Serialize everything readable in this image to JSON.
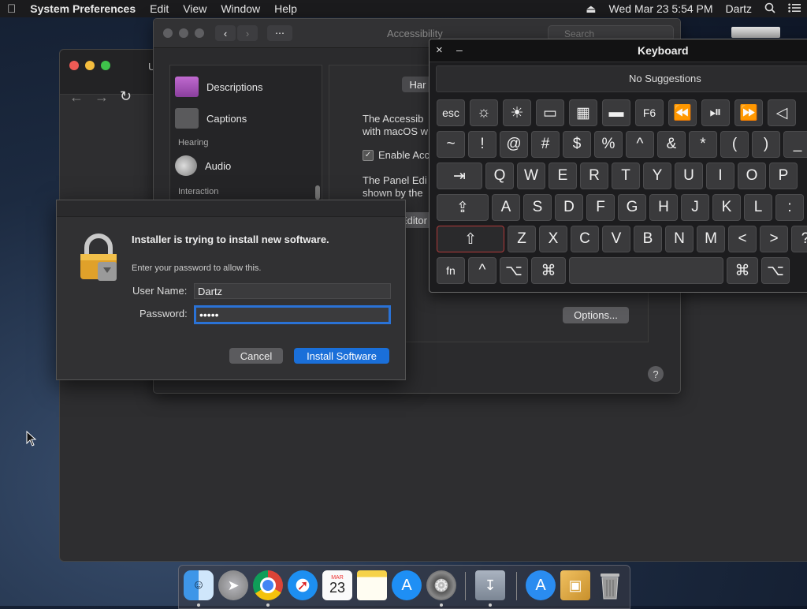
{
  "menubar": {
    "app_name": "System Preferences",
    "menus": [
      "Edit",
      "View",
      "Window",
      "Help"
    ],
    "datetime": "Wed Mar 23  5:54 PM",
    "user": "Dartz"
  },
  "browser": {
    "tab_initial": "U"
  },
  "accessibility": {
    "window_title": "Accessibility",
    "search_placeholder": "Search",
    "sidebar": {
      "items": [
        {
          "label": "Descriptions",
          "icon": "descriptions-icon"
        },
        {
          "label": "Captions",
          "icon": "captions-icon"
        },
        {
          "label": "Audio",
          "icon": "speaker-icon"
        }
      ],
      "headers": [
        "Hearing",
        "Interaction"
      ]
    },
    "panel": {
      "tab_label": "Har",
      "text_line1": "The Accessib",
      "text_line2": "with macOS w",
      "checkbox_label": "Enable Acc",
      "checkbox_checked": true,
      "text_line3": "The Panel Edi",
      "text_line4": "shown by the",
      "editor_button": "Editor",
      "options_button": "Options..."
    },
    "help_button": "?"
  },
  "installer": {
    "title": "Installer is trying to install new software.",
    "subtitle": "Enter your password to allow this.",
    "username_label": "User Name:",
    "username_value": "Dartz",
    "password_label": "Password:",
    "password_value": "•••••",
    "cancel_label": "Cancel",
    "install_label": "Install Software"
  },
  "keyboard": {
    "title": "Keyboard",
    "close": "×",
    "minimize": "–",
    "suggestions": "No Suggestions",
    "rows": [
      [
        "esc",
        "☼",
        "☀",
        "▭",
        "▦",
        "▬",
        "F6",
        "⏪",
        "⏯",
        "⏩",
        "◁"
      ],
      [
        "~",
        "!",
        "@",
        "#",
        "$",
        "%",
        "^",
        "&",
        "*",
        "(",
        ")",
        "_"
      ],
      [
        "⇥",
        "Q",
        "W",
        "E",
        "R",
        "T",
        "Y",
        "U",
        "I",
        "O",
        "P"
      ],
      [
        "⇪",
        "A",
        "S",
        "D",
        "F",
        "G",
        "H",
        "J",
        "K",
        "L",
        ":"
      ],
      [
        "⇧",
        "Z",
        "X",
        "C",
        "V",
        "B",
        "N",
        "M",
        "<",
        ">",
        "?"
      ],
      [
        "fn",
        "^",
        "⌥",
        "⌘",
        "",
        "⌘",
        "⌥"
      ]
    ]
  },
  "dock": {
    "apps": [
      "Finder",
      "Launchpad",
      "Chrome",
      "Safari",
      "Calendar",
      "Notes",
      "App Store",
      "System Preferences",
      "Downloads",
      "Applications",
      "Installer",
      "Trash"
    ],
    "calendar_month": "MAR",
    "calendar_day": "23"
  },
  "colors": {
    "accent": "#1a6fd9",
    "key_bg": "#3a3a3c",
    "menubar": "#1b1b1d"
  }
}
